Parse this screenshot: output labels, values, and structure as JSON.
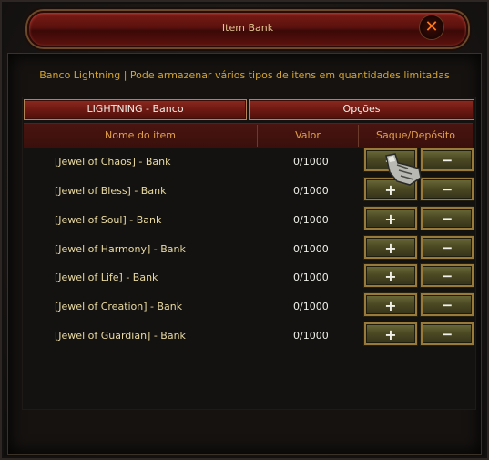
{
  "window": {
    "title": "Item Bank"
  },
  "description": "Banco Lightning | Pode armazenar vários tipos de itens em quantidades limitadas",
  "tabs": [
    {
      "label": "LIGHTNING - Banco"
    },
    {
      "label": "Opções"
    }
  ],
  "table": {
    "headers": {
      "name": "Nome do item",
      "value": "Valor",
      "actions": "Saque/Depósito"
    },
    "rows": [
      {
        "name": "[Jewel of Chaos] - Bank",
        "value": "0/1000"
      },
      {
        "name": "[Jewel of Bless] - Bank",
        "value": "0/1000"
      },
      {
        "name": "[Jewel of Soul] - Bank",
        "value": "0/1000"
      },
      {
        "name": "[Jewel of Harmony] - Bank",
        "value": "0/1000"
      },
      {
        "name": "[Jewel of Life] - Bank",
        "value": "0/1000"
      },
      {
        "name": "[Jewel of Creation] - Bank",
        "value": "0/1000"
      },
      {
        "name": "[Jewel of Guardian] - Bank",
        "value": "0/1000"
      }
    ],
    "buttons": {
      "plus": "+",
      "minus": "−"
    }
  },
  "icons": {
    "close": "close-icon",
    "cursor": "hand-cursor-icon"
  },
  "colors": {
    "title": "#e4c591",
    "description": "#d4a534",
    "header": "#e2a14a",
    "item_name": "#e8d9a0"
  }
}
